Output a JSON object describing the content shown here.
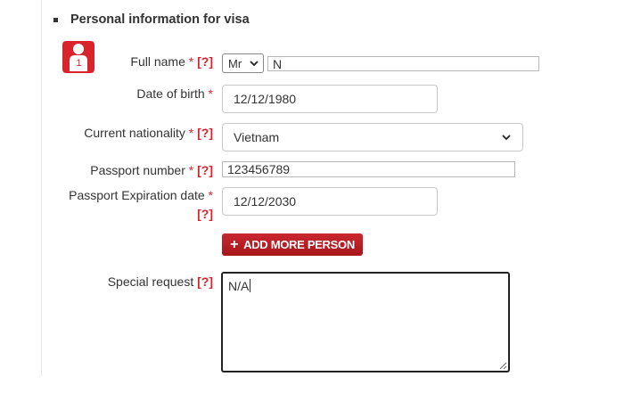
{
  "section": {
    "title": "Personal information for visa"
  },
  "person": {
    "number": "1"
  },
  "labels": {
    "required_mark": "*",
    "help_mark": "[?]",
    "full_name": "Full name",
    "date_of_birth": "Date of birth",
    "current_nationality": "Current nationality",
    "passport_number": "Passport number",
    "passport_expiration": "Passport Expiration date",
    "special_request": "Special request"
  },
  "fields": {
    "title_select": "Mr",
    "full_name": "N",
    "date_of_birth": "12/12/1980",
    "nationality": "Vietnam",
    "passport_number": "123456789",
    "passport_expiration": "12/12/2030",
    "special_request": "N/A"
  },
  "buttons": {
    "add_more_person": "ADD MORE PERSON",
    "add_plus": "+"
  },
  "icons": {
    "bullet": "square-bullet-icon",
    "person": "person-icon",
    "dropdown": "chevron-down-icon",
    "resize": "resize-grip-icon"
  },
  "colors": {
    "accent": "#d8242b",
    "button": "#b81f24",
    "text": "#333333"
  }
}
